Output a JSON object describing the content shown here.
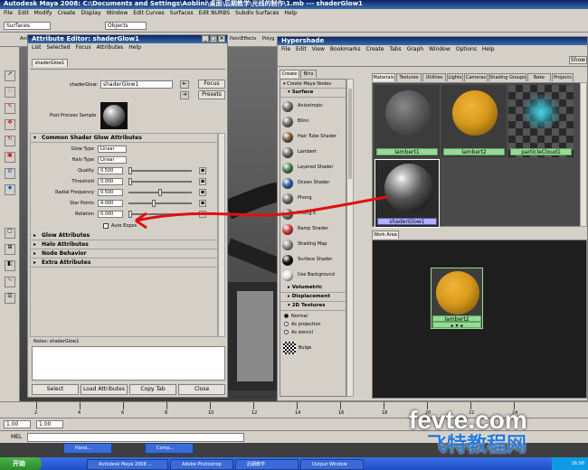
{
  "maya": {
    "title": "Autodesk Maya 2008: C:\\Documents and Settings\\Aoblini\\桌面\\后期教学\\光线的制作\\1.mb   ---   shaderGlow1",
    "menus": [
      "File",
      "Edit",
      "Modify",
      "Create",
      "Display",
      "Window",
      "Edit Curves",
      "Surfaces",
      "Edit NURBS",
      "Subdiv Surfaces",
      "Help"
    ],
    "mode": "Surfaces",
    "selection_field": "Objects",
    "shelf_tabs": [
      "Anim",
      "PaintEffects",
      "Polyg"
    ],
    "hidden_label": "Show"
  },
  "attribute_editor": {
    "title": "Attribute Editor: shaderGlow1",
    "menus": [
      "List",
      "Selected",
      "Focus",
      "Attributes",
      "Help"
    ],
    "tab": "shaderGlow1",
    "shader_label": "shaderGlow:",
    "shader_value": "shaderGlow1",
    "focus_btn": "Focus",
    "presets_btn": "Presets",
    "sample_label": "Post Process Sample",
    "common_section": "Common Shader Glow Attributes",
    "attributes": [
      {
        "label": "Glow Type",
        "value": "Linear",
        "kind": "dropdown"
      },
      {
        "label": "Halo Type",
        "value": "Linear",
        "kind": "dropdown"
      },
      {
        "label": "Quality",
        "value": "0.500",
        "kind": "slider",
        "level": 0.0
      },
      {
        "label": "Threshold",
        "value": "0.000",
        "kind": "slider",
        "level": 0.0
      },
      {
        "label": "Radial Frequency",
        "value": "0.500",
        "kind": "slider",
        "level": 0.5
      },
      {
        "label": "Star Points",
        "value": "4.000",
        "kind": "slider",
        "level": 0.4
      },
      {
        "label": "Rotation",
        "value": "0.000",
        "kind": "slider",
        "level": 0.0
      }
    ],
    "auto_exposure": "Auto Expos",
    "sections": [
      "Glow Attributes",
      "Halo Attributes",
      "Node Behavior",
      "Extra Attributes"
    ],
    "notes_label": "Notes: shaderGlow1",
    "buttons": [
      "Select",
      "Load Attributes",
      "Copy Tab",
      "Close"
    ]
  },
  "hypershade": {
    "title": "Hypershade",
    "menus": [
      "File",
      "Edit",
      "View",
      "Bookmarks",
      "Create",
      "Tabs",
      "Graph",
      "Window",
      "Options",
      "Help"
    ],
    "left_tabs": [
      "Create",
      "Bins"
    ],
    "create_header": "Create Maya Nodes",
    "surface_header": "Surface",
    "nodes": [
      {
        "label": "Anisotropic",
        "color": "#6e6e6e"
      },
      {
        "label": "Blinn",
        "color": "#6a6a6a"
      },
      {
        "label": "Hair Tube Shader",
        "color": "#7a5a3a"
      },
      {
        "label": "Lambert",
        "color": "#666666"
      },
      {
        "label": "Layered Shader",
        "color": "#4a7c4a"
      },
      {
        "label": "Ocean Shader",
        "color": "#2f5f9f"
      },
      {
        "label": "Phong",
        "color": "#6a6a6a"
      },
      {
        "label": "Phong E",
        "color": "#6a6a6a"
      },
      {
        "label": "Ramp Shader",
        "color": "#c83c3c"
      },
      {
        "label": "Shading Map",
        "color": "#8a8a8a"
      },
      {
        "label": "Surface Shader",
        "color": "#111111"
      },
      {
        "label": "Use Background",
        "color": "#e0e0e0"
      }
    ],
    "collapsed_sections": [
      "Volumetric",
      "Displacement",
      "2D Textures"
    ],
    "radio_options": [
      "Normal",
      "As projection",
      "As stencil"
    ],
    "bulge_label": "Bulge",
    "top_tabs": [
      "Materials",
      "Textures",
      "Utilities",
      "Lights",
      "Cameras",
      "Shading Groups",
      "Bake Sets",
      "Projects"
    ],
    "materials": [
      {
        "label": "lambert1",
        "color": "#5a5a5a"
      },
      {
        "label": "lambert2",
        "color": "#d89a1a"
      },
      {
        "label": "particleCloud1",
        "color": "#2aa8b8"
      },
      {
        "label": "shaderGlow1",
        "color": "#3a3a3a"
      }
    ],
    "work_area_tab": "Work Area",
    "work_node": "lambert2"
  },
  "timeline": {
    "ticks": [
      "2",
      "4",
      "6",
      "8",
      "10",
      "12",
      "14",
      "16",
      "18",
      "20",
      "22",
      "24"
    ],
    "start1": "1.00",
    "start2": "1.00",
    "mel_label": "MEL"
  },
  "watermark": {
    "line1": "fevte.com",
    "line2": "飞特教程网"
  },
  "taskbar": {
    "start_label": "开始",
    "items": [
      "Autodesk Maya 2008 ...",
      "Adobe Photoshop",
      "后期教学",
      "Output Window"
    ],
    "floating_items": [
      "Hand...",
      "Comp..."
    ],
    "clock": "16:58"
  },
  "colors": {
    "title_blue": "#0a246a",
    "panel_gray": "#d4d0c8",
    "annotation_red": "#e01010",
    "selected_green": "#9ad89a"
  }
}
